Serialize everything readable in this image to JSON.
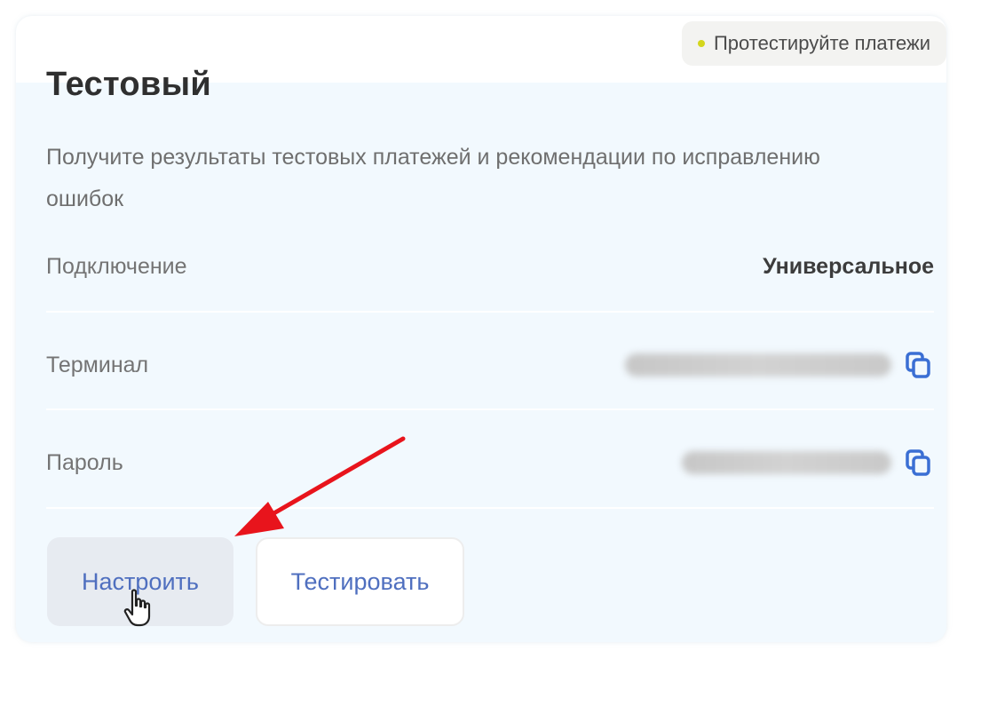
{
  "card": {
    "badge_text": "Протестируйте платежи",
    "title": "Тестовый",
    "subtitle": "Получите результаты тестовых платежей и рекомендации по исправлению ошибок",
    "rows": [
      {
        "label": "Подключение",
        "value": "Универсальное"
      },
      {
        "label": "Терминал"
      },
      {
        "label": "Пароль"
      }
    ],
    "buttons": {
      "setup": "Настроить",
      "test": "Тестировать"
    }
  },
  "icons": {
    "copy": "copy-icon",
    "cursor": "hand-pointer-icon",
    "annotation": "red-arrow-icon"
  },
  "colors": {
    "accent": "#4f6fbf",
    "copy_icon": "#3b6fd4",
    "badge_dot": "#d4d61c",
    "annotation_arrow": "#e8141c"
  }
}
